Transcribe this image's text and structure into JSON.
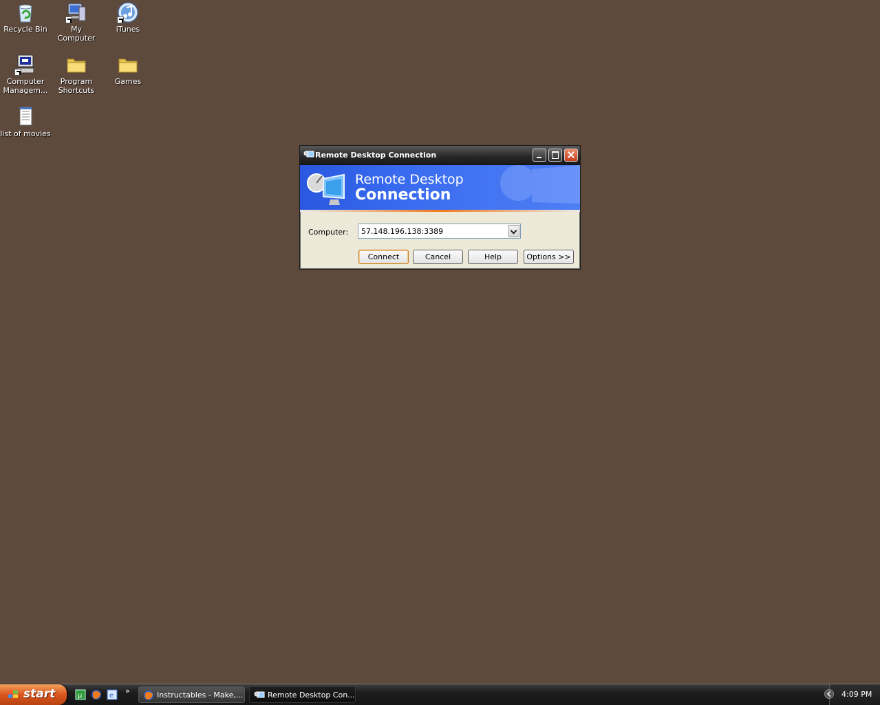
{
  "desktop": {
    "icons": [
      {
        "label": "Recycle Bin",
        "icon": "recycle-bin-icon"
      },
      {
        "label": "My Computer",
        "icon": "my-computer-icon"
      },
      {
        "label": "iTunes",
        "icon": "itunes-icon"
      },
      {
        "label": "Computer Managem...",
        "icon": "computer-management-icon"
      },
      {
        "label": "Program Shortcuts",
        "icon": "folder-icon"
      },
      {
        "label": "Games",
        "icon": "folder-icon"
      },
      {
        "label": "list of movies",
        "icon": "text-document-icon"
      }
    ],
    "background_color": "#5e4a3d"
  },
  "window": {
    "title": "Remote Desktop Connection",
    "banner_line1": "Remote Desktop",
    "banner_line2": "Connection",
    "computer_label": "Computer:",
    "computer_value": "57.148.196.138:3389",
    "buttons": {
      "connect": "Connect",
      "cancel": "Cancel",
      "help": "Help",
      "options": "Options >>"
    }
  },
  "taskbar": {
    "start_label": "start",
    "quicklaunch_more": "»",
    "tasks": [
      {
        "label": "Instructables - Make,...",
        "icon": "firefox-icon"
      },
      {
        "label": "Remote Desktop Con...",
        "icon": "remote-desktop-icon"
      }
    ],
    "clock": "4:09 PM"
  }
}
